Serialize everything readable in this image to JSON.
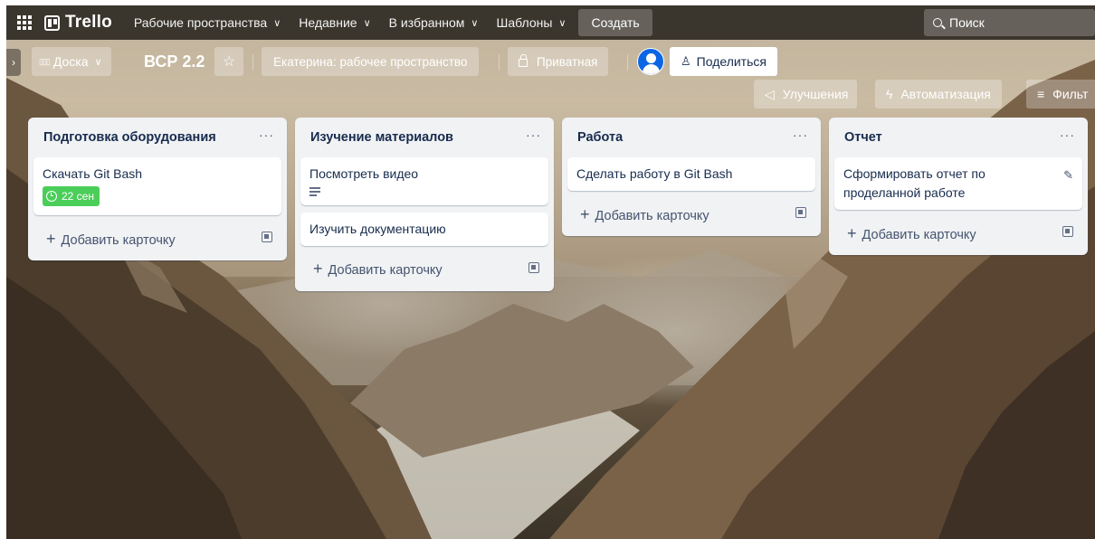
{
  "topnav": {
    "logo": "Trello",
    "items": [
      {
        "label": "Рабочие пространства"
      },
      {
        "label": "Недавние"
      },
      {
        "label": "В избранном"
      },
      {
        "label": "Шаблоны"
      }
    ],
    "create_label": "Создать",
    "search_placeholder": "Поиск"
  },
  "board": {
    "view_label": "Доска",
    "title": "ВСР 2.2",
    "workspace_label": "Екатерина: рабочее пространство",
    "visibility_label": "Приватная",
    "share_label": "Поделиться",
    "improvements_label": "Улучшения",
    "automation_label": "Автоматизация",
    "filter_label": "Фильт"
  },
  "lists": [
    {
      "title": "Подготовка оборудования",
      "menu": "···",
      "cards": [
        {
          "text": "Скачать Git Bash",
          "due": "22 сен"
        }
      ],
      "add_label": "Добавить карточку"
    },
    {
      "title": "Изучение материалов",
      "menu": "···",
      "cards": [
        {
          "text": "Посмотреть видео",
          "has_description": true
        },
        {
          "text": "Изучить документацию"
        }
      ],
      "add_label": "Добавить карточку"
    },
    {
      "title": "Работа",
      "menu": "···",
      "cards": [
        {
          "text": "Сделать работу в Git Bash"
        }
      ],
      "add_label": "Добавить карточку"
    },
    {
      "title": "Отчет",
      "menu": "···",
      "cards": [
        {
          "text": "Сформировать отчет по проделанной работе"
        }
      ],
      "add_label": "Добавить карточку"
    }
  ],
  "colors": {
    "due_badge": "#4bce59",
    "avatar": "#0c66e4",
    "list_bg": "#f1f2f4"
  }
}
